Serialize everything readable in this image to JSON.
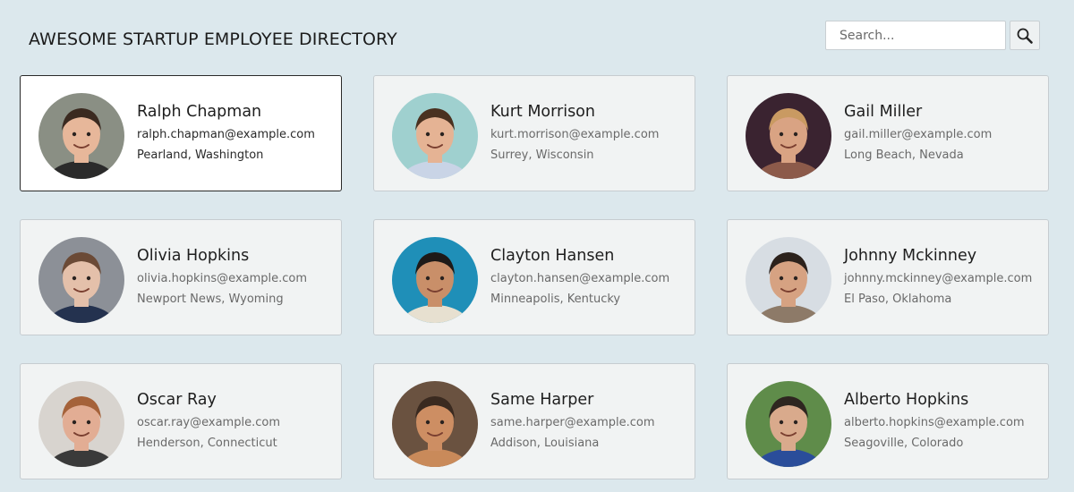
{
  "header": {
    "title": "AWESOME STARTUP EMPLOYEE DIRECTORY"
  },
  "search": {
    "placeholder": "Search...",
    "value": "",
    "button_icon": "search-icon"
  },
  "employees": [
    {
      "name": "Ralph Chapman",
      "email": "ralph.chapman@example.com",
      "location": "Pearland, Washington",
      "active": true,
      "photo": {
        "bg": "#8a8f84",
        "skin": "#e7b79a",
        "hair": "#3b2a20",
        "shirt": "#2b2b2b"
      }
    },
    {
      "name": "Kurt Morrison",
      "email": "kurt.morrison@example.com",
      "location": "Surrey, Wisconsin",
      "active": false,
      "photo": {
        "bg": "#9fd0cf",
        "skin": "#e5b394",
        "hair": "#4a3120",
        "shirt": "#c9d4e6"
      }
    },
    {
      "name": "Gail Miller",
      "email": "gail.miller@example.com",
      "location": "Long Beach, Nevada",
      "active": false,
      "photo": {
        "bg": "#3a2330",
        "skin": "#d9a383",
        "hair": "#c99a62",
        "shirt": "#8c5a4a"
      }
    },
    {
      "name": "Olivia Hopkins",
      "email": "olivia.hopkins@example.com",
      "location": "Newport News, Wyoming",
      "active": false,
      "photo": {
        "bg": "#8c9097",
        "skin": "#e4c0aa",
        "hair": "#6b4a36",
        "shirt": "#24324f"
      }
    },
    {
      "name": "Clayton Hansen",
      "email": "clayton.hansen@example.com",
      "location": "Minneapolis, Kentucky",
      "active": false,
      "photo": {
        "bg": "#1f8fb8",
        "skin": "#c98f69",
        "hair": "#1e1a18",
        "shirt": "#e7e0d0"
      }
    },
    {
      "name": "Johnny Mckinney",
      "email": "johnny.mckinney@example.com",
      "location": "El Paso, Oklahoma",
      "active": false,
      "photo": {
        "bg": "#d7dde3",
        "skin": "#d6a282",
        "hair": "#2c221c",
        "shirt": "#8d7a68"
      }
    },
    {
      "name": "Oscar Ray",
      "email": "oscar.ray@example.com",
      "location": "Henderson, Connecticut",
      "active": false,
      "photo": {
        "bg": "#d8d4cf",
        "skin": "#e2ad94",
        "hair": "#a5623a",
        "shirt": "#3a3a3a"
      }
    },
    {
      "name": "Same Harper",
      "email": "same.harper@example.com",
      "location": "Addison, Louisiana",
      "active": false,
      "photo": {
        "bg": "#6a5240",
        "skin": "#cd8e63",
        "hair": "#3a2a20",
        "shirt": "#c98a5a"
      }
    },
    {
      "name": "Alberto Hopkins",
      "email": "alberto.hopkins@example.com",
      "location": "Seagoville, Colorado",
      "active": false,
      "photo": {
        "bg": "#5f8c4a",
        "skin": "#d9aa8c",
        "hair": "#2e2620",
        "shirt": "#2a4d9a"
      }
    }
  ]
}
